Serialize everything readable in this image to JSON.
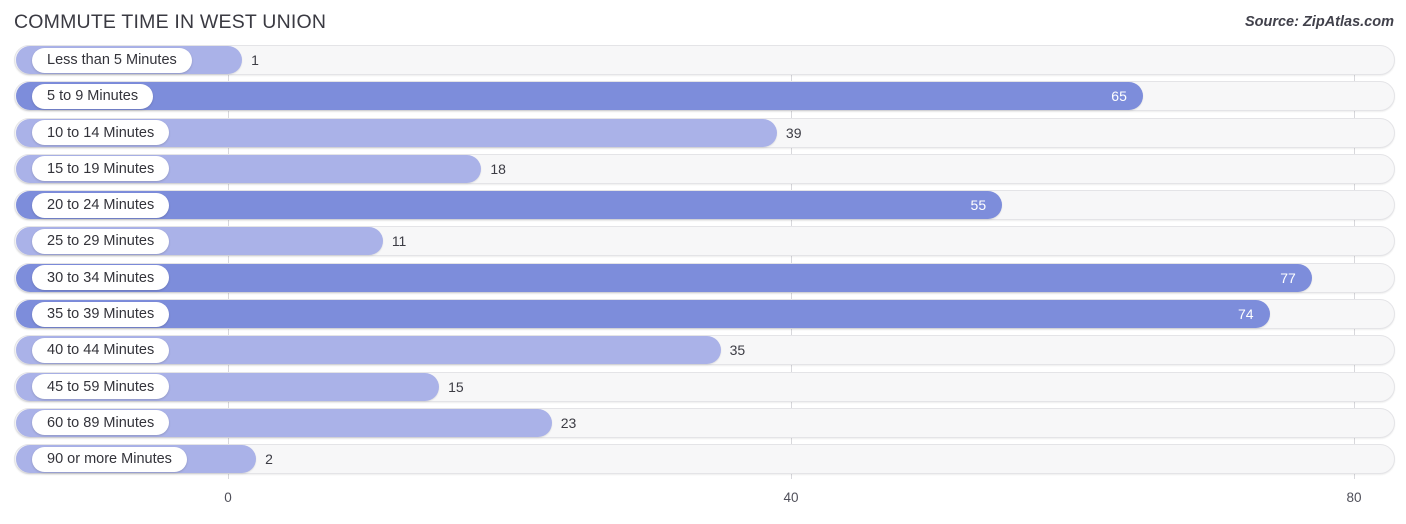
{
  "header": {
    "title": "COMMUTE TIME IN WEST UNION",
    "source": "Source: ZipAtlas.com"
  },
  "colors": {
    "bar_dark": "#7d8ddb",
    "bar_light": "#aab2e8",
    "track": "#f7f7f8",
    "gridline": "#d8d8dc",
    "title_text": "#3a3a42"
  },
  "chart_data": {
    "type": "bar",
    "orientation": "horizontal",
    "title": "COMMUTE TIME IN WEST UNION",
    "xlabel": "",
    "ylabel": "",
    "xlim": [
      0,
      80
    ],
    "xticks": [
      0,
      40,
      80
    ],
    "xtick_labels": [
      "0",
      "40",
      "80"
    ],
    "grid": true,
    "legend": false,
    "categories": [
      "Less than 5 Minutes",
      "5 to 9 Minutes",
      "10 to 14 Minutes",
      "15 to 19 Minutes",
      "20 to 24 Minutes",
      "25 to 29 Minutes",
      "30 to 34 Minutes",
      "35 to 39 Minutes",
      "40 to 44 Minutes",
      "45 to 59 Minutes",
      "60 to 89 Minutes",
      "90 or more Minutes"
    ],
    "values": [
      1,
      65,
      39,
      18,
      55,
      11,
      77,
      74,
      35,
      15,
      23,
      2
    ],
    "value_labels": [
      "1",
      "65",
      "39",
      "18",
      "55",
      "11",
      "77",
      "74",
      "35",
      "15",
      "23",
      "2"
    ],
    "label_placement": [
      "outside",
      "inside",
      "outside",
      "outside",
      "inside",
      "outside",
      "inside",
      "inside",
      "outside",
      "outside",
      "outside",
      "outside"
    ],
    "bar_shades": [
      "light",
      "dark",
      "light",
      "light",
      "dark",
      "light",
      "dark",
      "dark",
      "light",
      "light",
      "light",
      "light"
    ]
  }
}
